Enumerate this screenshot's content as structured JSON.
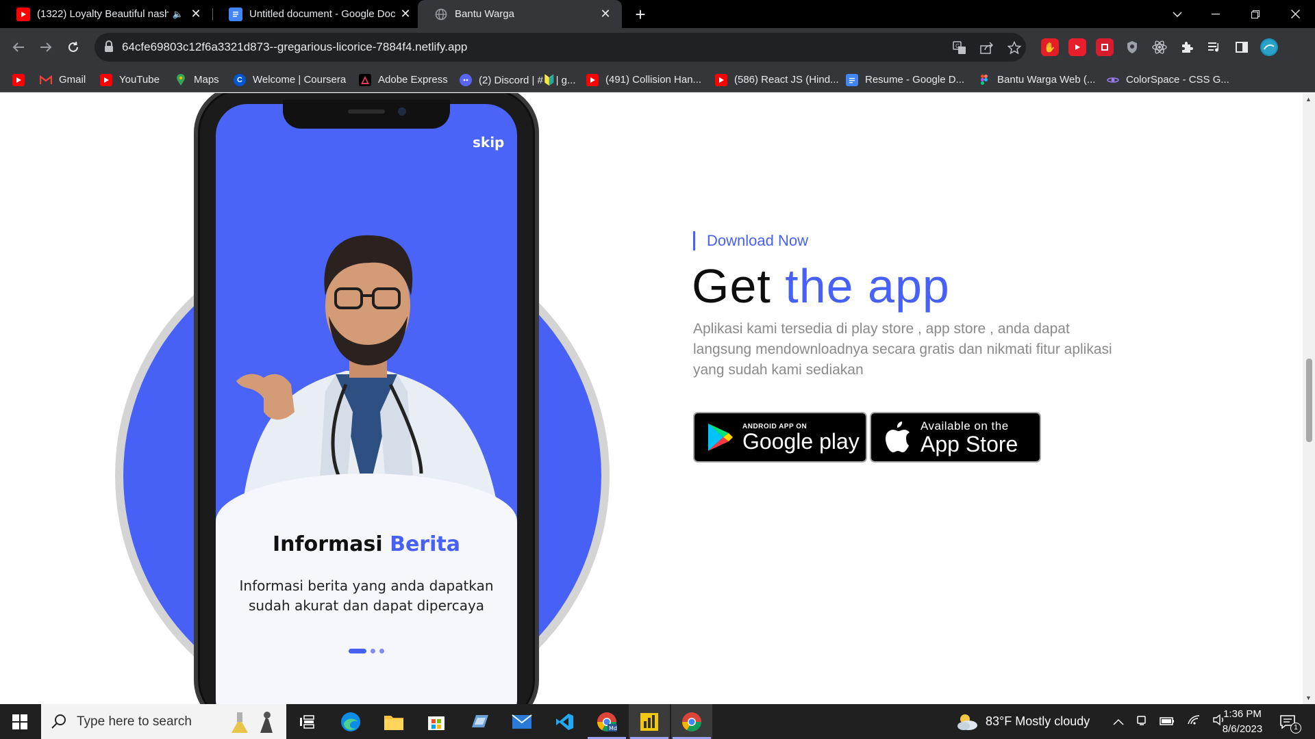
{
  "browser": {
    "tabs": [
      {
        "title": "(1322) Loyalty Beautiful nash",
        "favicon": "youtube-icon",
        "active": false
      },
      {
        "title": "Untitled document - Google Doc",
        "favicon": "google-docs-icon",
        "active": false
      },
      {
        "title": "Bantu Warga",
        "favicon": "globe-icon",
        "active": true
      }
    ],
    "url": "64cfe69803c12f6a3321d873--gregarious-licorice-7884f4.netlify.app",
    "bookmarks": [
      {
        "label": "",
        "icon": "youtube-icon"
      },
      {
        "label": "Gmail",
        "icon": "gmail-icon"
      },
      {
        "label": "YouTube",
        "icon": "youtube-icon"
      },
      {
        "label": "Maps",
        "icon": "maps-icon"
      },
      {
        "label": "Welcome | Coursera",
        "icon": "coursera-icon"
      },
      {
        "label": "Adobe Express",
        "icon": "adobe-express-icon"
      },
      {
        "label": "(2) Discord | #🔰| g...",
        "icon": "discord-icon"
      },
      {
        "label": "(491) Collision Han...",
        "icon": "youtube-icon"
      },
      {
        "label": "(586) React JS (Hind...",
        "icon": "youtube-icon"
      },
      {
        "label": "Resume - Google D...",
        "icon": "google-docs-icon"
      },
      {
        "label": "Bantu Warga Web (...",
        "icon": "figma-icon"
      },
      {
        "label": "ColorSpace - CSS G...",
        "icon": "colorspace-icon"
      }
    ]
  },
  "page": {
    "phone": {
      "skip_label": "skip",
      "title_primary": "Informasi",
      "title_accent": "Berita",
      "description": "Informasi berita yang anda dapatkan sudah akurat dan dapat dipercaya",
      "carousel": {
        "total": 3,
        "current": 1
      }
    },
    "download_label": "Download Now",
    "headline_primary": "Get",
    "headline_accent": "the app",
    "paragraph": "Aplikasi kami tersedia di play store , app store , anda dapat langsung mendownloadnya secara gratis dan nikmati fitur aplikasi yang sudah kami sediakan",
    "google_play": {
      "small": "ANDROID APP ON",
      "big": "Google play"
    },
    "app_store": {
      "small": "Available on the",
      "big": "App Store"
    },
    "colors": {
      "accent": "#4760f5",
      "text_dark": "#0d0d0d",
      "text_muted": "#8a8a8a"
    }
  },
  "taskbar": {
    "search_placeholder": "Type here to search",
    "weather": "83°F  Mostly cloudy",
    "time": "1:36 PM",
    "date": "8/6/2023",
    "notification_count": "1",
    "apps": [
      "task-view-icon",
      "edge-icon",
      "file-explorer-icon",
      "store-icon",
      "app-icon",
      "mail-icon",
      "vscode-icon",
      "chrome-md-icon",
      "powerbi-icon",
      "chrome-icon"
    ]
  }
}
